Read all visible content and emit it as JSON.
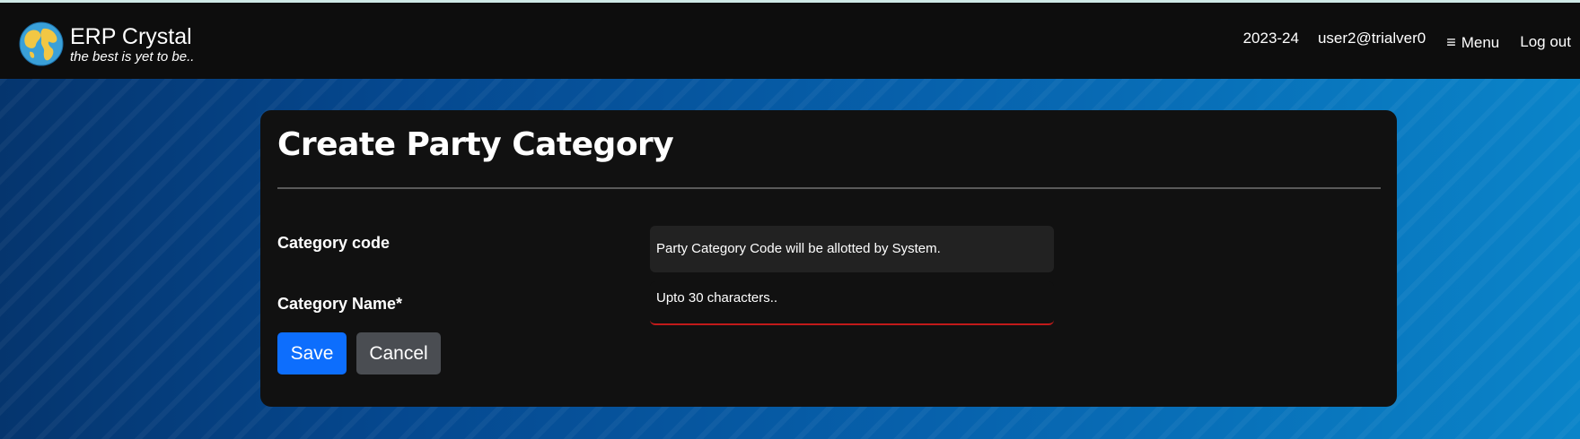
{
  "header": {
    "brand_title": "ERP Crystal",
    "brand_tagline": "the best is yet to be..",
    "fiscal_year": "2023-24",
    "user": "user2@trialver0",
    "menu_label": "Menu",
    "logout_label": "Log out",
    "logo_icon": "globe-icon",
    "menu_icon": "hamburger-icon"
  },
  "form": {
    "title": "Create Party Category",
    "fields": [
      {
        "label": "Category code",
        "value": "Party Category Code will be allotted by System."
      },
      {
        "label": "Category Name*",
        "value": "",
        "placeholder": "Upto 30 characters.."
      }
    ],
    "save_label": "Save",
    "cancel_label": "Cancel"
  },
  "colors": {
    "navbar": "#0d0d0d",
    "card": "#111111",
    "save_button": "#0d6efd",
    "cancel_button": "#4a4d52",
    "invalid_underline": "#c11a1a"
  }
}
